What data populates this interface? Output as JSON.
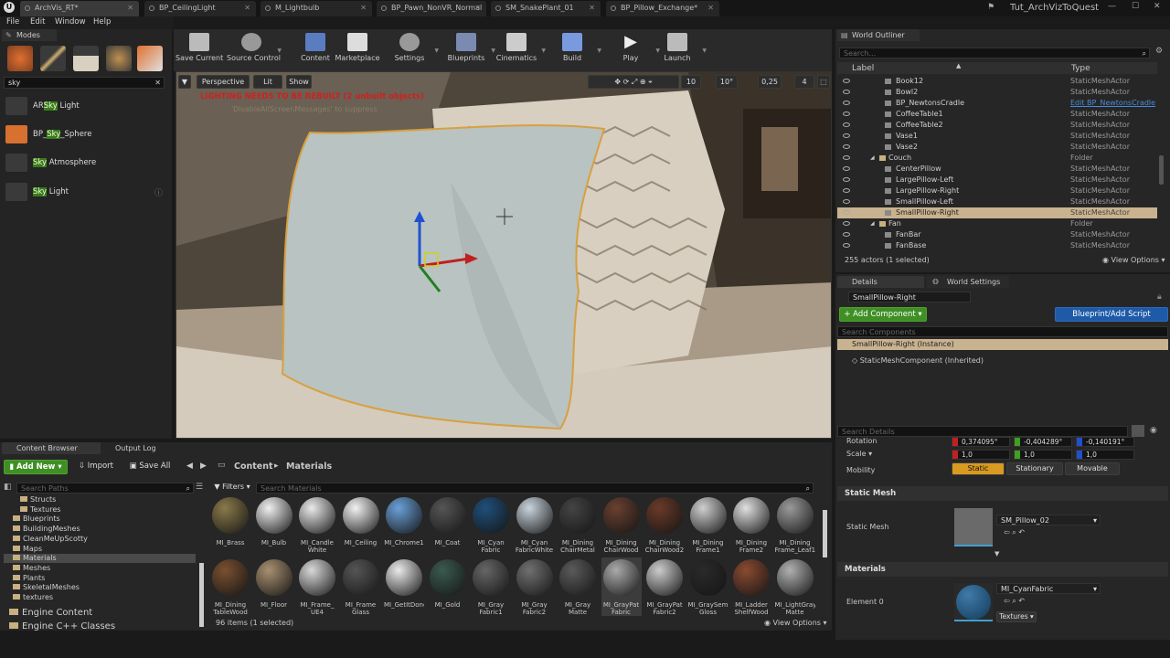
{
  "tabs": [
    {
      "label": "ArchVis_RT*"
    },
    {
      "label": "BP_CeilingLight"
    },
    {
      "label": "M_Lightbulb"
    },
    {
      "label": "BP_Pawn_NonVR_Normal"
    },
    {
      "label": "SM_SnakePlant_01"
    },
    {
      "label": "BP_Pillow_Exchange*"
    }
  ],
  "project_name": "Tut_ArchVizToQuest",
  "menu": [
    "File",
    "Edit",
    "Window",
    "Help"
  ],
  "modes": {
    "tab": "Modes",
    "search_value": "sky",
    "items": [
      {
        "pre": "AR",
        "hl": "Sky",
        "post": " Light"
      },
      {
        "pre": "BP_",
        "hl": "Sky",
        "post": "_Sphere"
      },
      {
        "pre": "",
        "hl": "Sky",
        "post": " Atmosphere"
      },
      {
        "pre": "",
        "hl": "Sky",
        "post": " Light"
      }
    ]
  },
  "toolbar": [
    "Save Current",
    "Source Control",
    "Content",
    "Marketplace",
    "Settings",
    "Blueprints",
    "Cinematics",
    "Build",
    "Play",
    "Launch"
  ],
  "viewport": {
    "perspective": "Perspective",
    "lit": "Lit",
    "show": "Show",
    "warning": "LIGHTING NEEDS TO BE REBUILT (2 unbuilt objects)",
    "warning_sub": "'DisableAllScreenMessages' to suppress",
    "grid": "10",
    "angle": "10°",
    "scale": "0,25",
    "camera": "4"
  },
  "outliner": {
    "tab": "World Outliner",
    "search_placeholder": "Search...",
    "col_label": "Label",
    "col_type": "Type",
    "rows": [
      {
        "name": "Book12",
        "type": "StaticMeshActor",
        "indent": 2
      },
      {
        "name": "Bowl2",
        "type": "StaticMeshActor",
        "indent": 2
      },
      {
        "name": "BP_NewtonsCradle",
        "type": "Edit BP_NewtonsCradle",
        "indent": 2,
        "link": true
      },
      {
        "name": "CoffeeTable1",
        "type": "StaticMeshActor",
        "indent": 2
      },
      {
        "name": "CoffeeTable2",
        "type": "StaticMeshActor",
        "indent": 2
      },
      {
        "name": "Vase1",
        "type": "StaticMeshActor",
        "indent": 2
      },
      {
        "name": "Vase2",
        "type": "StaticMeshActor",
        "indent": 2
      },
      {
        "name": "Couch",
        "type": "Folder",
        "indent": 1,
        "folder": true
      },
      {
        "name": "CenterPillow",
        "type": "StaticMeshActor",
        "indent": 2
      },
      {
        "name": "LargePillow-Left",
        "type": "StaticMeshActor",
        "indent": 2
      },
      {
        "name": "LargePillow-Right",
        "type": "StaticMeshActor",
        "indent": 2
      },
      {
        "name": "SmallPillow-Left",
        "type": "StaticMeshActor",
        "indent": 2
      },
      {
        "name": "SmallPillow-Right",
        "type": "StaticMeshActor",
        "indent": 2,
        "selected": true
      },
      {
        "name": "Fan",
        "type": "Folder",
        "indent": 1,
        "folder": true
      },
      {
        "name": "FanBar",
        "type": "StaticMeshActor",
        "indent": 2
      },
      {
        "name": "FanBase",
        "type": "StaticMeshActor",
        "indent": 2
      }
    ],
    "status": "255 actors (1 selected)",
    "view_options": "View Options"
  },
  "details": {
    "tab": "Details",
    "tab2": "World Settings",
    "actor_name": "SmallPillow-Right",
    "add_component": "+ Add Component",
    "blueprint_script": "Blueprint/Add Script",
    "search_components": "Search Components",
    "instance": "SmallPillow-Right (Instance)",
    "component": "StaticMeshComponent (Inherited)",
    "search_details": "Search Details",
    "rotation_label": "Rotation",
    "rotation": [
      "0,374095°",
      "-0,404289°",
      "-0,140191°"
    ],
    "scale_label": "Scale",
    "scale": [
      "1,0",
      "1,0",
      "1,0"
    ],
    "mobility_label": "Mobility",
    "mobility": [
      "Static",
      "Stationary",
      "Movable"
    ],
    "sec_static_mesh": "Static Mesh",
    "static_mesh_label": "Static Mesh",
    "static_mesh_value": "SM_Pillow_02",
    "sec_materials": "Materials",
    "element_label": "Element 0",
    "material_value": "MI_CyanFabric",
    "textures": "Textures"
  },
  "content_browser": {
    "tab": "Content Browser",
    "tab2": "Output Log",
    "add_new": "Add New",
    "import": "Import",
    "save_all": "Save All",
    "path": [
      "Content",
      "Materials"
    ],
    "search_paths": "Search Paths",
    "filters": "Filters",
    "search_materials": "Search Materials",
    "tree": [
      "Structs",
      "Textures",
      "Blueprints",
      "BuildingMeshes",
      "CleanMeUpScotty",
      "Maps",
      "Materials",
      "Meshes",
      "Plants",
      "SkeletalMeshes",
      "textures"
    ],
    "tree_bottom": [
      "Engine Content",
      "Engine C++ Classes"
    ],
    "row1": [
      "MI_Brass",
      "MI_Bulb",
      "MI_Candle White",
      "MI_Ceiling",
      "MI_Chrome1",
      "MI_Coat",
      "MI_Cyan Fabric",
      "MI_Cyan FabricWhite",
      "MI_Dining ChairMetal",
      "MI_Dining ChairWood",
      "MI_Dining ChairWood2",
      "MI_Dining Frame1",
      "MI_Dining Frame2",
      "MI_Dining Frame_Leaf1"
    ],
    "row2": [
      "MI_Dining TableWood",
      "MI_Floor",
      "MI_Frame_ UE4",
      "MI_Frame Glass",
      "MI_GetItDone",
      "MI_Gold",
      "MI_Gray Fabric1",
      "MI_Gray Fabric2",
      "MI_Gray Matte",
      "MI_GrayPat Fabric",
      "MI_GrayPat Fabric2",
      "MI_GraySemi Gloss",
      "MI_Ladder ShelfWood",
      "MI_LightGray Matte"
    ],
    "status": "96 items (1 selected)",
    "view_options": "View Options"
  }
}
